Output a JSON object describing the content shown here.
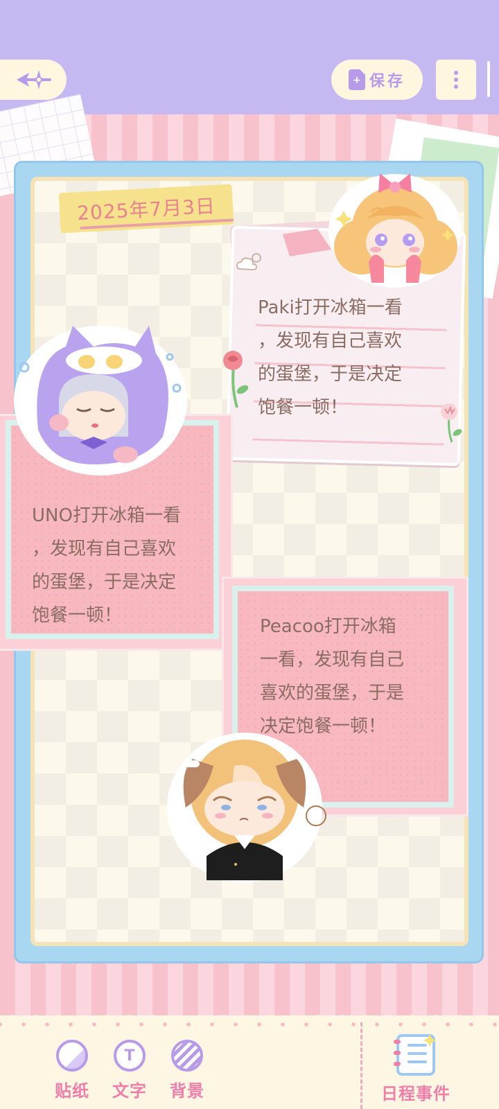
{
  "header": {
    "back_icon": "sparkle-arrow-left-icon",
    "save_label": "保存",
    "save_icon": "file-icon",
    "more_icon": "vertical-dots-icon"
  },
  "canvas": {
    "date": "2025年7月3日",
    "notes": [
      {
        "id": "paki",
        "text": "Paki打开冰箱一看\n，发现有自己喜欢\n的蛋堡，于是决定\n饱餐一顿！"
      },
      {
        "id": "uno",
        "text": "UNO打开冰箱一看\n，发现有自己喜欢\n的蛋堡，于是决定\n饱餐一顿！"
      },
      {
        "id": "peacoo",
        "text": "Peacoo打开冰箱\n一看，发现有自己\n喜欢的蛋堡，于是\n决定饱餐一顿！"
      }
    ]
  },
  "toolbar": {
    "items": [
      {
        "label": "贴纸",
        "icon": "sticker-icon"
      },
      {
        "label": "文字",
        "icon": "text-icon",
        "glyph": "T"
      },
      {
        "label": "背景",
        "icon": "background-icon"
      }
    ],
    "schedule_label": "日程事件",
    "schedule_icon": "schedule-notebook-icon"
  },
  "colors": {
    "header_bg": "#c6b8f0",
    "accent_purple": "#b79ae8",
    "accent_pink": "#f07eaa",
    "note_pink": "#f7b8bf",
    "frame_blue": "#a9d6f0"
  }
}
